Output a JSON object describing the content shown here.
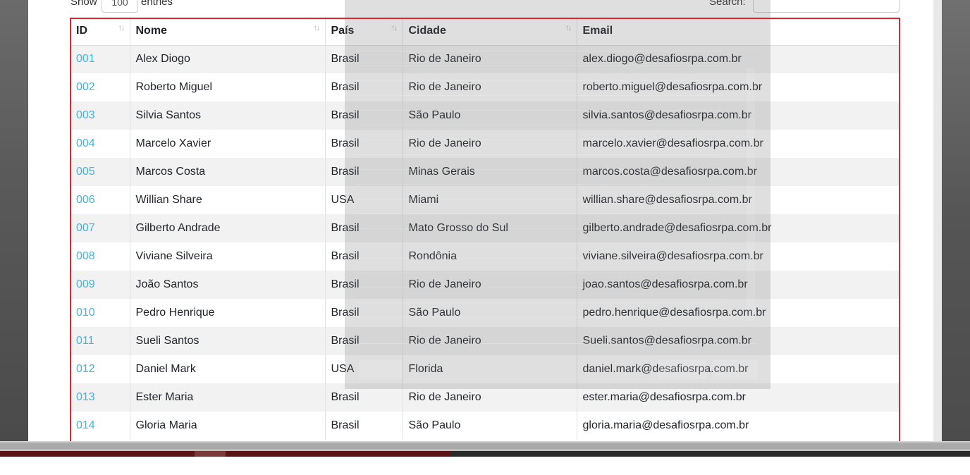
{
  "controls": {
    "show_label": "Show",
    "length_value": "100",
    "entries_label": "entries",
    "search_label": "Search:"
  },
  "table": {
    "columns": [
      "ID",
      "Nome",
      "País",
      "Cidade",
      "Email"
    ],
    "rows": [
      {
        "id": "001",
        "nome": "Alex Diogo",
        "pais": "Brasil",
        "cidade": "Rio de Janeiro",
        "email": "alex.diogo@desafiosrpa.com.br"
      },
      {
        "id": "002",
        "nome": "Roberto Miguel",
        "pais": "Brasil",
        "cidade": "Rio de Janeiro",
        "email": "roberto.miguel@desafiosrpa.com.br"
      },
      {
        "id": "003",
        "nome": "Silvia Santos",
        "pais": "Brasil",
        "cidade": "São Paulo",
        "email": "silvia.santos@desafiosrpa.com.br"
      },
      {
        "id": "004",
        "nome": "Marcelo Xavier",
        "pais": "Brasil",
        "cidade": "Rio de Janeiro",
        "email": "marcelo.xavier@desafiosrpa.com.br"
      },
      {
        "id": "005",
        "nome": "Marcos Costa",
        "pais": "Brasil",
        "cidade": "Minas Gerais",
        "email": "marcos.costa@desafiosrpa.com.br"
      },
      {
        "id": "006",
        "nome": "Willian Share",
        "pais": "USA",
        "cidade": "Miami",
        "email": "willian.share@desafiosrpa.com.br"
      },
      {
        "id": "007",
        "nome": "Gilberto Andrade",
        "pais": "Brasil",
        "cidade": "Mato Grosso do Sul",
        "email": "gilberto.andrade@desafiosrpa.com.br"
      },
      {
        "id": "008",
        "nome": "Viviane Silveira",
        "pais": "Brasil",
        "cidade": "Rondônia",
        "email": "viviane.silveira@desafiosrpa.com.br"
      },
      {
        "id": "009",
        "nome": "João Santos",
        "pais": "Brasil",
        "cidade": "Rio de Janeiro",
        "email": "joao.santos@desafiosrpa.com.br"
      },
      {
        "id": "010",
        "nome": "Pedro Henrique",
        "pais": "Brasil",
        "cidade": "São Paulo",
        "email": "pedro.henrique@desafiosrpa.com.br"
      },
      {
        "id": "011",
        "nome": "Sueli Santos",
        "pais": "Brasil",
        "cidade": "Rio de Janeiro",
        "email": "Sueli.santos@desafiosrpa.com.br"
      },
      {
        "id": "012",
        "nome": "Daniel Mark",
        "pais": "USA",
        "cidade": "Florida",
        "email": "daniel.mark@desafiosrpa.com.br"
      },
      {
        "id": "013",
        "nome": "Ester Maria",
        "pais": "Brasil",
        "cidade": "Rio de Janeiro",
        "email": "ester.maria@desafiosrpa.com.br"
      },
      {
        "id": "014",
        "nome": "Gloria Maria",
        "pais": "Brasil",
        "cidade": "São Paulo",
        "email": "gloria.maria@desafiosrpa.com.br"
      }
    ]
  },
  "sort_icon": "sort-arrows-icon",
  "colors": {
    "link": "#3bb6e8",
    "stripe": "#f2f2f2",
    "selection": "#e1242d"
  }
}
